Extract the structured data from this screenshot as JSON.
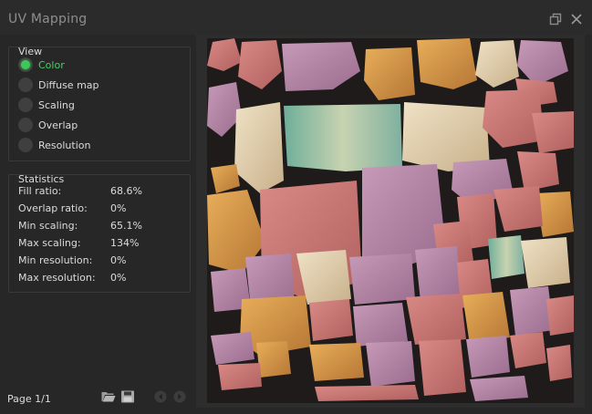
{
  "window": {
    "title": "UV Mapping",
    "icons": [
      "restore-icon",
      "close-icon"
    ]
  },
  "view": {
    "group_title": "View",
    "options": [
      {
        "label": "Color",
        "selected": true
      },
      {
        "label": "Diffuse map",
        "selected": false
      },
      {
        "label": "Scaling",
        "selected": false
      },
      {
        "label": "Overlap",
        "selected": false
      },
      {
        "label": "Resolution",
        "selected": false
      }
    ]
  },
  "statistics": {
    "group_title": "Statistics",
    "rows": [
      {
        "name": "Fill ratio:",
        "value": "68.6%"
      },
      {
        "name": "Overlap ratio:",
        "value": "0%"
      },
      {
        "name": "Min scaling:",
        "value": "65.1%"
      },
      {
        "name": "Max scaling:",
        "value": "134%"
      },
      {
        "name": "Min resolution:",
        "value": "0%"
      },
      {
        "name": "Max resolution:",
        "value": "0%"
      }
    ]
  },
  "footer": {
    "page_label": "Page 1/1",
    "icons": [
      "open-folder-icon",
      "save-icon",
      "previous-page-icon",
      "next-page-icon"
    ]
  },
  "colors": {
    "accent": "#3ec85a",
    "background": "#272727",
    "viewport": "#2d2d2d"
  }
}
